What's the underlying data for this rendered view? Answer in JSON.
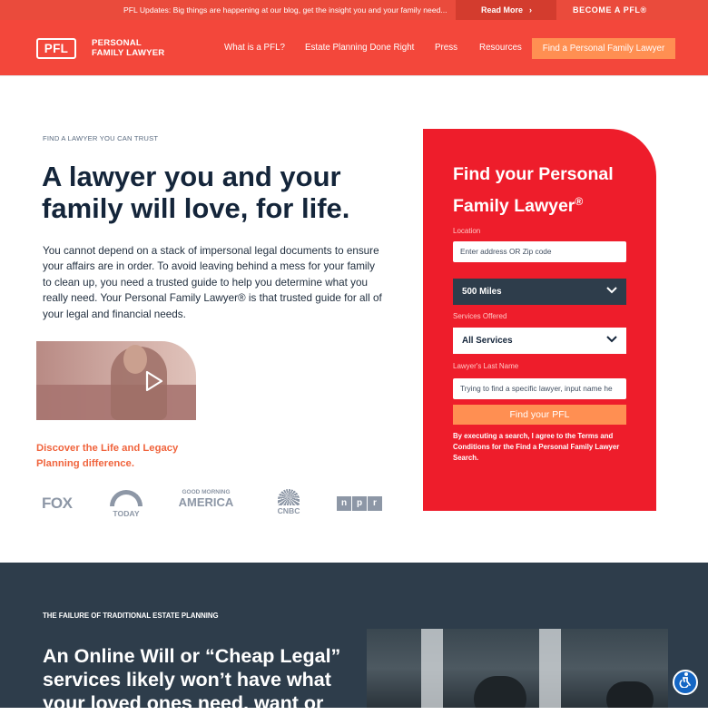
{
  "topbar": {
    "message": "PFL Updates: Big things are happening at our blog, get the insight you and your family need...",
    "read_more": "Read More",
    "become": "BECOME A PFL®"
  },
  "nav": {
    "logo": "PFL",
    "brand_line1": "PERSONAL",
    "brand_line2": "FAMILY LAWYER",
    "links": [
      "What is a PFL?",
      "Estate Planning Done Right",
      "Press",
      "Resources"
    ],
    "cta": "Find a Personal Family Lawyer"
  },
  "hero": {
    "eyebrow": "FIND A LAWYER YOU CAN TRUST",
    "headline": "A lawyer you and your family will love, for life.",
    "paragraph": "You cannot depend on a stack of impersonal legal documents to ensure your affairs are in order. To avoid leaving behind a mess for your family to clean up, you need a trusted guide to help you determine what you really need. Your Personal Family Lawyer® is that trusted guide for all of your legal and financial needs.",
    "discover": "Discover the Life and Legacy Planning difference.",
    "media": {
      "fox": "FOX",
      "today": "TODAY",
      "gma_top": "GOOD MORNING",
      "gma_bottom": "AMERICA",
      "cnbc": "CNBC",
      "npr": [
        "n",
        "p",
        "r"
      ]
    }
  },
  "search_card": {
    "title": "Find your Personal Family Lawyer",
    "title_mark": "®",
    "location_label": "Location",
    "location_placeholder": "Enter address OR Zip code",
    "distance": "500 Miles",
    "services_label": "Services Offered",
    "services": "All Services",
    "lastname_label": "Lawyer's Last Name",
    "lastname_placeholder": "Trying to find a specific lawyer, input name he",
    "submit": "Find your PFL",
    "terms": "By executing a search, I agree to the Terms and Conditions for the Find a Personal Family Lawyer Search."
  },
  "failure_section": {
    "eyebrow": "THE FAILURE OF TRADITIONAL ESTATE PLANNING",
    "headline": "An Online Will or “Cheap Legal” services likely won’t have what your loved ones need, want or"
  },
  "colors": {
    "brand_red": "#f3473b",
    "card_red": "#ee1d2b",
    "accent_orange": "#ff8f52",
    "dark_slate": "#2e3d4b"
  },
  "icons": [
    "chevron-right-icon",
    "play-icon",
    "chevron-down-icon",
    "accessibility-icon"
  ]
}
